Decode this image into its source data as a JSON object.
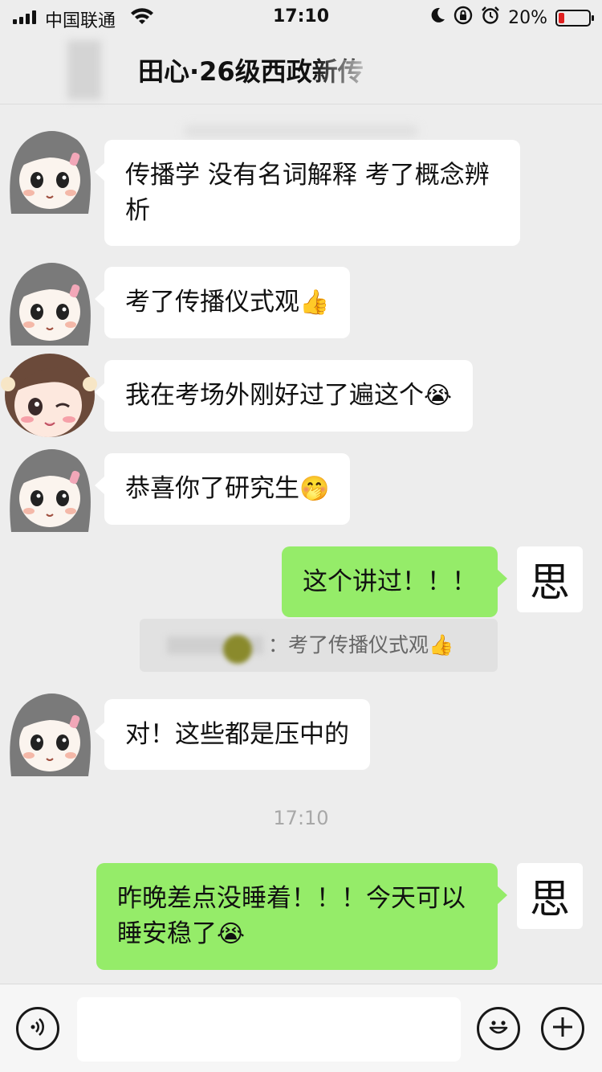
{
  "status_bar": {
    "carrier": "中国联通",
    "time": "17:10",
    "battery_percent": "20%",
    "battery_level": 0.2
  },
  "header": {
    "title": "田心·26级西政新传"
  },
  "messages": [
    {
      "side": "left",
      "text": "传播学 没有名词解释 考了概念辨析"
    },
    {
      "side": "left",
      "text": "考了传播仪式观",
      "emoji": "👍"
    },
    {
      "side": "left",
      "text": "我在考场外刚好过了遍这个",
      "emoji": "😭"
    },
    {
      "side": "left",
      "text": "恭喜你了研究生",
      "emoji": "🤭"
    },
    {
      "side": "right",
      "text": "这个讲过！！！"
    },
    {
      "side": "left",
      "text": "对！这些都是压中的"
    },
    {
      "side": "right",
      "text": "昨晚差点没睡着！！！今天可以睡安稳了",
      "emoji": "😭"
    }
  ],
  "quote": {
    "text": "：考了传播仪式观",
    "emoji": "👍"
  },
  "timestamp": "17:10",
  "my_avatar_char": "思",
  "icons": {
    "voice": "voice-icon",
    "emoji": "emoji-icon",
    "plus": "plus-icon"
  },
  "colors": {
    "background": "#ededed",
    "bubble_right": "#95ec69",
    "bubble_left": "#ffffff",
    "battery_low": "#e02020"
  }
}
